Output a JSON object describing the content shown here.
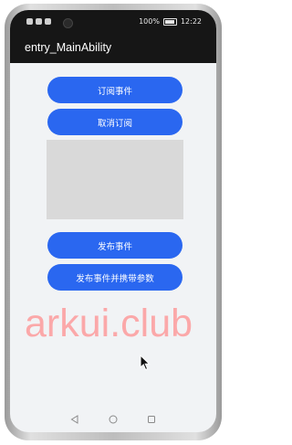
{
  "status_bar": {
    "battery_percent": "100%",
    "time": "12:22"
  },
  "app": {
    "title": "entry_MainAbility"
  },
  "buttons": {
    "subscribe": "订阅事件",
    "unsubscribe": "取消订阅",
    "publish": "发布事件",
    "publish_with_params": "发布事件并携带参数"
  },
  "watermark": {
    "text": "arkui.club",
    "color": "#ff8c8c"
  },
  "colors": {
    "button_bg": "#2a67f0",
    "screen_bg": "#f1f3f5",
    "title_bar_bg": "#161616",
    "placeholder_bg": "#d9d9d9"
  },
  "icons": {
    "nav_back": "triangle-back-icon",
    "nav_home": "circle-home-icon",
    "nav_recent": "square-recent-icon",
    "cursor": "mouse-pointer-icon"
  }
}
